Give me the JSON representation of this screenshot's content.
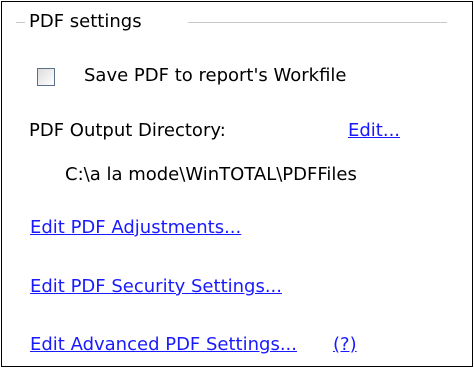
{
  "group": {
    "title": "PDF settings"
  },
  "save_to_workfile": {
    "label": "Save PDF to report's Workfile",
    "checked": false
  },
  "output_directory": {
    "label": "PDF Output Directory:",
    "edit_link": "Edit...",
    "path": "C:\\a la mode\\WinTOTAL\\PDFFiles"
  },
  "links": {
    "adjustments": "Edit PDF Adjustments...",
    "security": "Edit PDF Security Settings...",
    "advanced": "Edit Advanced PDF Settings...",
    "help": "(?)"
  },
  "colors": {
    "link": "#1a1aff",
    "border": "#000000",
    "group_line": "#c8c8c8"
  }
}
